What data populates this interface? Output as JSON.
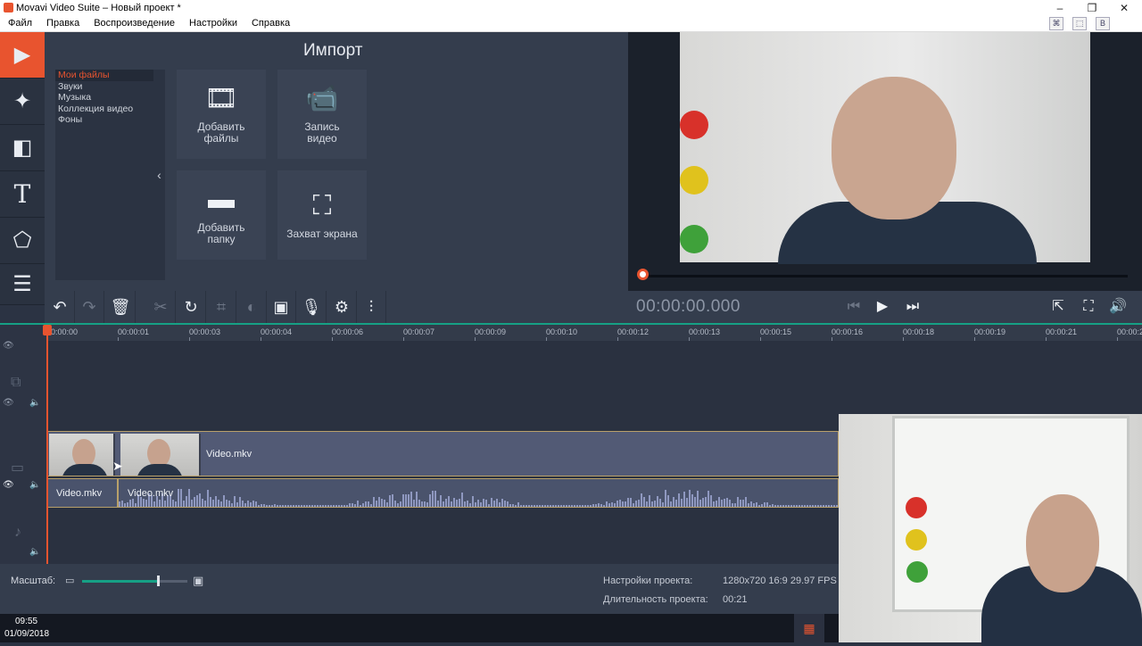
{
  "window": {
    "title": "Movavi Video Suite – Новый проект *",
    "minimize": "–",
    "restore": "❐",
    "close": "✕"
  },
  "menu": [
    "Файл",
    "Правка",
    "Воспроизведение",
    "Настройки",
    "Справка"
  ],
  "tray_icons": [
    {
      "name": "tray-icon-1",
      "glyph": "⌘"
    },
    {
      "name": "tray-icon-2",
      "glyph": "⬚"
    },
    {
      "name": "tray-icon-3",
      "glyph": "В"
    }
  ],
  "sidebar": [
    {
      "name": "import-video-tool",
      "icon": "film-icon",
      "glyph": "▶"
    },
    {
      "name": "filters-tool",
      "icon": "magic-wand-icon",
      "glyph": "✦"
    },
    {
      "name": "transitions-tool",
      "icon": "transition-icon",
      "glyph": "◧"
    },
    {
      "name": "titles-tool",
      "icon": "text-icon",
      "glyph": "T"
    },
    {
      "name": "stickers-tool",
      "icon": "shapes-icon",
      "glyph": "⬠"
    },
    {
      "name": "more-tools",
      "icon": "list-icon",
      "glyph": "☰"
    }
  ],
  "import": {
    "title": "Импорт",
    "categories": [
      "Мои файлы",
      "Звуки",
      "Музыка",
      "Коллекция видео",
      "Фоны"
    ],
    "collapse_glyph": "‹",
    "tiles": [
      {
        "name": "add-files-tile",
        "icon": "media-files-icon",
        "glyph": "🎞",
        "label": "Добавить\nфайлы"
      },
      {
        "name": "record-video-tile",
        "icon": "camera-icon",
        "glyph": "📹",
        "label": "Запись\nвидео"
      },
      {
        "name": "add-folder-tile",
        "icon": "folder-icon",
        "glyph": "▬",
        "label": "Добавить\nпапку"
      },
      {
        "name": "screen-capture-tile",
        "icon": "screen-capture-icon",
        "glyph": "⛶",
        "label": "Захват экрана"
      }
    ]
  },
  "toolbar": [
    {
      "name": "undo-button",
      "icon": "undo-icon",
      "glyph": "↶",
      "enabled": true
    },
    {
      "name": "redo-button",
      "icon": "redo-icon",
      "glyph": "↷",
      "enabled": false
    },
    {
      "name": "delete-button",
      "icon": "trash-icon",
      "glyph": "🗑",
      "enabled": true
    },
    {
      "name": "cut-button",
      "icon": "scissors-icon",
      "glyph": "✂",
      "enabled": false
    },
    {
      "name": "rotate-button",
      "icon": "rotate-icon",
      "glyph": "↻",
      "enabled": true
    },
    {
      "name": "crop-button",
      "icon": "crop-icon",
      "glyph": "⌗",
      "enabled": false
    },
    {
      "name": "color-adjust-button",
      "icon": "contrast-icon",
      "glyph": "◐",
      "enabled": false
    },
    {
      "name": "image-button",
      "icon": "image-icon",
      "glyph": "▣",
      "enabled": true
    },
    {
      "name": "record-audio-button",
      "icon": "microphone-icon",
      "glyph": "🎙",
      "enabled": true
    },
    {
      "name": "clip-properties-button",
      "icon": "gear-icon",
      "glyph": "⚙",
      "enabled": true
    },
    {
      "name": "equalizer-button",
      "icon": "equalizer-icon",
      "glyph": "⫶",
      "enabled": true
    }
  ],
  "player": {
    "timecode": "00:00:00.000",
    "controls": [
      {
        "name": "previous-frame-button",
        "icon": "skip-back-icon",
        "glyph": "⏮"
      },
      {
        "name": "play-button",
        "icon": "play-icon",
        "glyph": "▶"
      },
      {
        "name": "next-frame-button",
        "icon": "skip-forward-icon",
        "glyph": "⏭"
      }
    ],
    "right_controls": [
      {
        "name": "export-button",
        "icon": "export-icon",
        "glyph": "⇱"
      },
      {
        "name": "fullscreen-button",
        "icon": "fullscreen-icon",
        "glyph": "⛶"
      },
      {
        "name": "volume-button",
        "icon": "speaker-icon",
        "glyph": "🔊"
      }
    ],
    "progress": 0
  },
  "ruler": [
    "00:00:00",
    "00:00:01",
    "00:00:03",
    "00:00:04",
    "00:00:06",
    "00:00:07",
    "00:00:09",
    "00:00:10",
    "00:00:12",
    "00:00:13",
    "00:00:15",
    "00:00:16",
    "00:00:18",
    "00:00:19",
    "00:00:21",
    "00:00:2"
  ],
  "tracks": {
    "video_clip": "Video.mkv",
    "audio_clips": [
      "Video.mkv",
      "Video.mkv"
    ]
  },
  "bottom": {
    "zoom_label": "Масштаб:",
    "zoom_level": 0.72,
    "settings_label": "Настройки проекта:",
    "settings_value": "1280x720 16:9 29.97 FPS",
    "duration_label": "Длительность проекта:",
    "duration_value": "00:21"
  },
  "taskbar": {
    "time": "09:55",
    "date": "01/09/2018"
  },
  "colors": {
    "accent": "#e8542f",
    "timeline_green": "#16a085",
    "clip_border": "#b8a06a"
  }
}
